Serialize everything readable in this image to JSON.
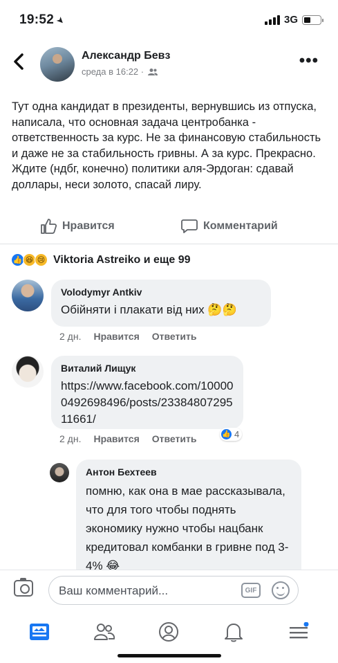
{
  "status_bar": {
    "time": "19:52",
    "network": "3G"
  },
  "post": {
    "author": "Александр Бевз",
    "timestamp": "среда в 16:22 ·",
    "text": "Тут одна кандидат в президенты, вернувшись из отпуска, написала, что основная задача центробанка - ответственность за курс. Не за финансовую стабильность и даже не за стабильность гривны. А за курс. Прекрасно. Ждите (ндбг, конечно) политики аля-Эрдоган: сдавай доллары, неси золото, спасай лиру."
  },
  "actions": {
    "like": "Нравится",
    "comment": "Комментарий"
  },
  "reactions": {
    "summary": "Viktoria Astreiko и еще 99"
  },
  "comments": [
    {
      "name": "Volodymyr Antkiv",
      "text": "Обійняти і плакати від них 🤔🤔",
      "time": "2 дн.",
      "like": "Нравится",
      "reply": "Ответить"
    },
    {
      "name": "Виталий Лищук",
      "text": "https://www.facebook.com/100000492698496/posts/2338480729511661/",
      "time": "2 дн.",
      "like": "Нравится",
      "reply": "Ответить",
      "reaction_count": "4"
    },
    {
      "name": "Антон Бехтеев",
      "text": "помню, как она в мае рассказывала, что для того чтобы поднять экономику нужно чтобы нацбанк кредитовал комбанки в гривне под 3-4% 😂"
    }
  ],
  "composer": {
    "placeholder": "Ваш комментарий...",
    "gif_label": "GIF"
  },
  "tabs": [
    "news-feed-icon",
    "friends-icon",
    "profile-icon",
    "notifications-icon",
    "menu-icon"
  ],
  "colors": {
    "accent": "#1877f2",
    "bubble": "#eff1f3",
    "muted": "#65676b"
  }
}
